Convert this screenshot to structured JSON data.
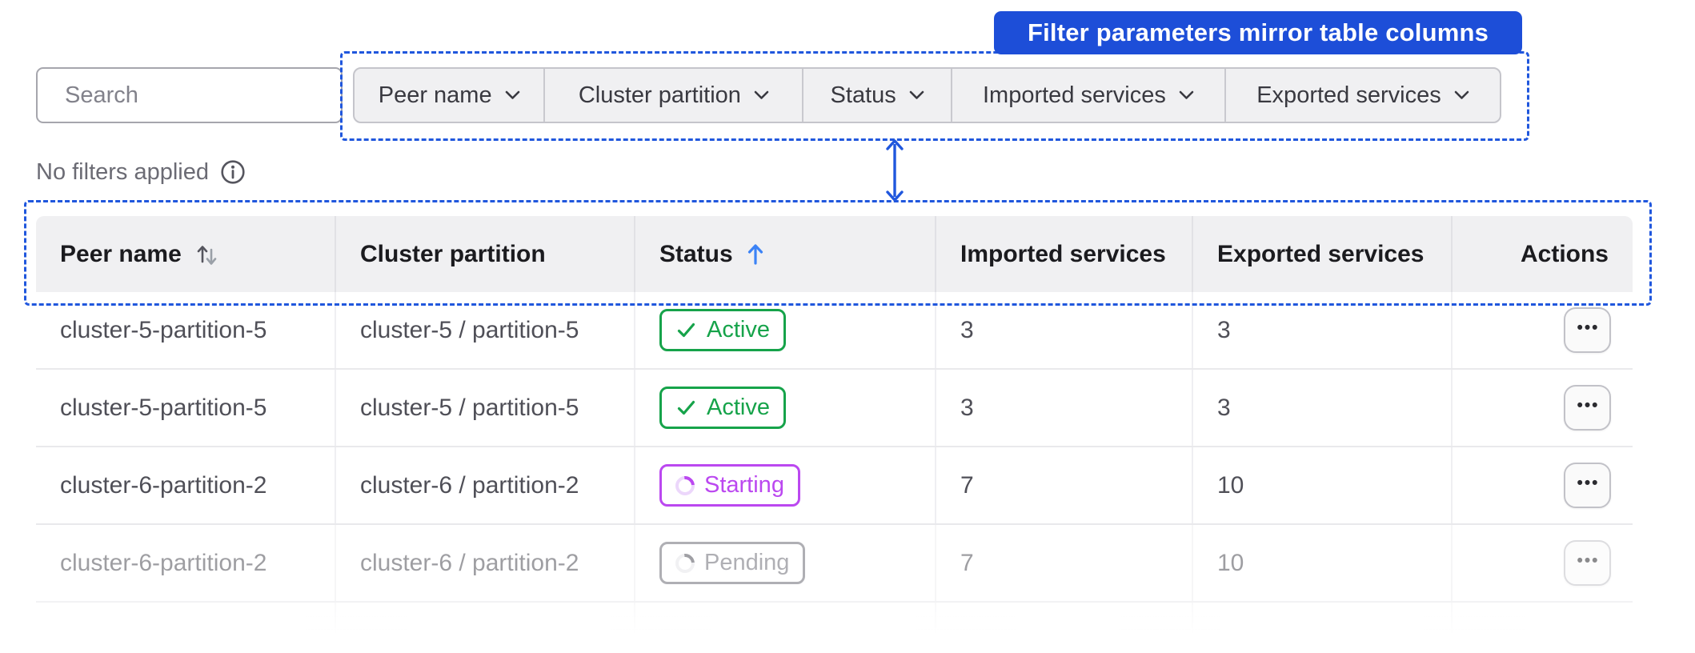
{
  "annotation": {
    "banner_label": "Filter parameters mirror table columns",
    "banner_bg": "#1d4ed8",
    "dashed_color": "#2057dd",
    "arrow_color": "#2057dd"
  },
  "search": {
    "placeholder": "Search"
  },
  "filters": {
    "items": [
      {
        "label": "Peer name"
      },
      {
        "label": "Cluster partition"
      },
      {
        "label": "Status"
      },
      {
        "label": "Imported services"
      },
      {
        "label": "Exported services"
      }
    ],
    "status_text": "No filters applied"
  },
  "table": {
    "columns": [
      {
        "label": "Peer name",
        "sort": "both"
      },
      {
        "label": "Cluster partition",
        "sort": "none"
      },
      {
        "label": "Status",
        "sort": "asc"
      },
      {
        "label": "Imported services",
        "sort": "none"
      },
      {
        "label": "Exported services",
        "sort": "none"
      },
      {
        "label": "Actions",
        "sort": "none",
        "align": "right"
      }
    ],
    "rows": [
      {
        "peer_name": "cluster-5-partition-5",
        "cluster_partition": "cluster-5 / partition-5",
        "status": "Active",
        "imported": "3",
        "exported": "3",
        "faded": false
      },
      {
        "peer_name": "cluster-5-partition-5",
        "cluster_partition": "cluster-5 / partition-5",
        "status": "Active",
        "imported": "3",
        "exported": "3",
        "faded": false
      },
      {
        "peer_name": "cluster-6-partition-2",
        "cluster_partition": "cluster-6 / partition-2",
        "status": "Starting",
        "imported": "7",
        "exported": "10",
        "faded": false
      },
      {
        "peer_name": "cluster-6-partition-2",
        "cluster_partition": "cluster-6 / partition-2",
        "status": "Pending",
        "imported": "7",
        "exported": "10",
        "faded": true
      }
    ],
    "actions_icon": "•••",
    "sort_active_color": "#3b82f6"
  },
  "badges": {
    "Active": {
      "color": "#16a34a",
      "icon": "check"
    },
    "Starting": {
      "color": "#bb48f0",
      "icon": "spinner",
      "track": "#ecd7fb",
      "arc": "#bb48f0"
    },
    "Pending": {
      "color": "#6e6e78",
      "icon": "spinner",
      "track": "#e6e6ea",
      "arc": "#52525b"
    }
  },
  "icons": {
    "search": "magnifier",
    "info": "circled-i",
    "chevron": "chevron-down",
    "sort_both": "up-down-arrows",
    "sort_asc": "up-arrow",
    "actions": "ellipsis"
  }
}
